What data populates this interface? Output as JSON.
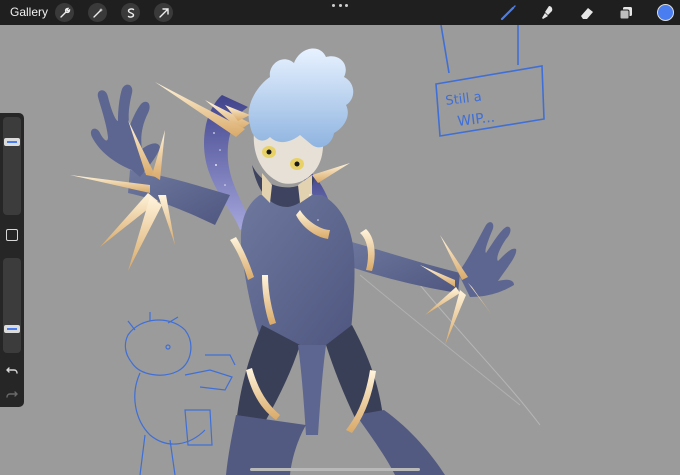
{
  "toolbar": {
    "gallery_label": "Gallery",
    "left_tools": [
      "wrench-icon",
      "magic-wand-icon",
      "selection-icon",
      "transform-arrow-icon"
    ],
    "right_tools": [
      "brush-icon",
      "smudge-icon",
      "eraser-icon",
      "layers-icon"
    ],
    "active_tool": "brush",
    "active_color": "#4a7df0"
  },
  "sidebar": {
    "brush_size": 0.78,
    "opacity": 0.22
  },
  "canvas": {
    "note_text_line1": "Still a",
    "note_text_line2": "WIP..."
  }
}
